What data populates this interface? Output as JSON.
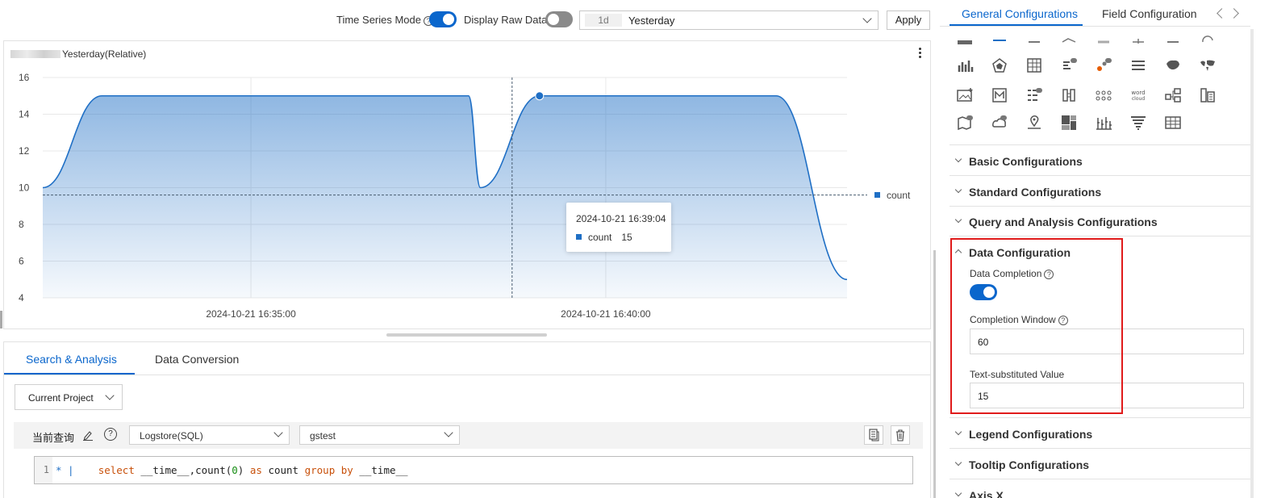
{
  "toolbar": {
    "time_series_mode_label": "Time Series Mode",
    "time_series_mode_on": true,
    "display_raw_data_label": "Display Raw Data",
    "display_raw_data_on": false,
    "time_tag": "1d",
    "time_value": "Yesterday",
    "apply_label": "Apply"
  },
  "chart_panel": {
    "title": "Yesterday(Relative)",
    "tooltip": {
      "time": "2024-10-21 16:39:04",
      "series": "count",
      "value": "15"
    },
    "legend": "count"
  },
  "chart_data": {
    "type": "area",
    "series": [
      {
        "name": "count",
        "color": "#1f6fc5"
      }
    ],
    "y_ticks": [
      "16",
      "14",
      "12",
      "10",
      "8",
      "6",
      "4"
    ],
    "x_ticks": [
      "2024-10-21 16:35:00",
      "2024-10-21 16:40:00"
    ],
    "ylim": [
      4,
      16
    ],
    "reference_line": 9.6,
    "points": [
      {
        "x": "16:32:04",
        "y": 10
      },
      {
        "x": "16:32:54",
        "y": 15
      },
      {
        "x": "16:38:04",
        "y": 15
      },
      {
        "x": "16:38:14",
        "y": 10
      },
      {
        "x": "16:39:04",
        "y": 15
      },
      {
        "x": "16:42:24",
        "y": 15
      },
      {
        "x": "16:43:24",
        "y": 5
      }
    ],
    "highlight_point": {
      "x": "16:39:04",
      "y": 15
    }
  },
  "query": {
    "tabs": [
      "Search & Analysis",
      "Data Conversion"
    ],
    "project_select": "Current Project",
    "label": "当前查询",
    "help": "?",
    "source_type": "Logstore(SQL)",
    "logstore": "gstest",
    "line_number": "1",
    "line_marker": "* |",
    "sql": {
      "select": "select",
      "time_field": " __time__,",
      "count_fn": "count(",
      "count_arg": "0",
      "paren_as": ") ",
      "as": "as",
      "alias": " count ",
      "group_by": "group by",
      "group_field": " __time__"
    }
  },
  "right_panel": {
    "tabs": [
      "General Configurations",
      "Field Configuration"
    ],
    "sections": {
      "basic": "Basic Configurations",
      "standard": "Standard Configurations",
      "query_analysis": "Query and Analysis Configurations",
      "data": "Data Configuration",
      "legend": "Legend Configurations",
      "tooltip": "Tooltip Configurations",
      "axis_x": "Axis X"
    },
    "data_completion_label": "Data Completion",
    "data_completion_on": true,
    "completion_window_label": "Completion Window",
    "completion_window_value": "60",
    "text_substituted_label": "Text-substituted Value",
    "text_substituted_value": "15",
    "icon_word_cloud": "word cloud"
  }
}
